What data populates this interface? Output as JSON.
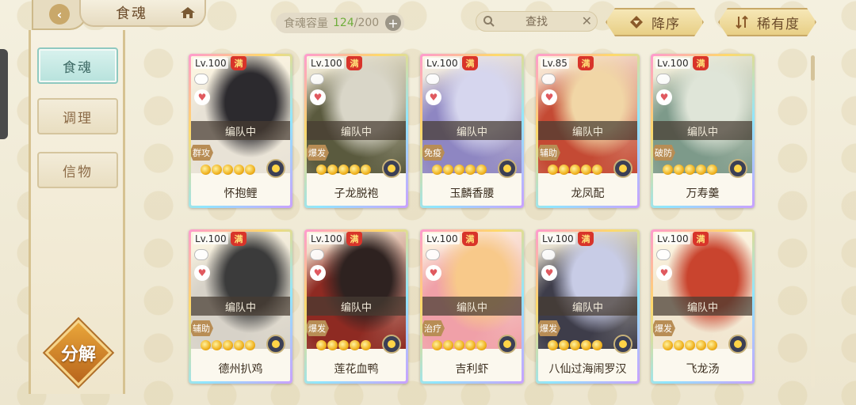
{
  "header": {
    "title": "食魂",
    "capacity_label": "食魂容量",
    "capacity_current": "124",
    "capacity_max": "/200",
    "add_label": "+",
    "search_placeholder": "查找",
    "sort_order_label": "降序",
    "sort_by_label": "稀有度"
  },
  "sidebar": {
    "items": [
      {
        "label": "食魂",
        "active": true
      },
      {
        "label": "调理",
        "active": false
      },
      {
        "label": "信物",
        "active": false
      }
    ],
    "decompose_label": "分解"
  },
  "cards": [
    {
      "level": "Lv.100",
      "max": "满",
      "status": "编队中",
      "role": "群攻",
      "name": "怀抱鲤",
      "palette": [
        "#2c2a2e",
        "#e8e2d6"
      ]
    },
    {
      "level": "Lv.100",
      "max": "满",
      "status": "编队中",
      "role": "爆发",
      "name": "子龙脱袍",
      "palette": [
        "#d9d6c8",
        "#5a5a3e"
      ]
    },
    {
      "level": "Lv.100",
      "max": "满",
      "status": "编队中",
      "role": "免疫",
      "name": "玉麟香腰",
      "palette": [
        "#d6d6ee",
        "#8e86c2"
      ]
    },
    {
      "level": "Lv.85",
      "max": "满",
      "status": "编队中",
      "role": "辅助",
      "name": "龙凤配",
      "palette": [
        "#f1d6a6",
        "#c44a34"
      ]
    },
    {
      "level": "Lv.100",
      "max": "满",
      "status": "编队中",
      "role": "破防",
      "name": "万寿羹",
      "palette": [
        "#dfe5d8",
        "#7d9a8a"
      ]
    },
    {
      "level": "Lv.100",
      "max": "满",
      "status": "编队中",
      "role": "辅助",
      "name": "德州扒鸡",
      "palette": [
        "#3b3b3b",
        "#d7d2c8"
      ]
    },
    {
      "level": "Lv.100",
      "max": "满",
      "status": "编队中",
      "role": "爆发",
      "name": "莲花血鸭",
      "palette": [
        "#2e2220",
        "#8e2a22"
      ]
    },
    {
      "level": "Lv.100",
      "max": "满",
      "status": "编队中",
      "role": "治疗",
      "name": "吉利虾",
      "palette": [
        "#f8c98a",
        "#f0a0a8"
      ]
    },
    {
      "level": "Lv.100",
      "max": "满",
      "status": "编队中",
      "role": "爆发",
      "name": "八仙过海闹罗汉",
      "palette": [
        "#c8cce6",
        "#3e3d4a"
      ]
    },
    {
      "level": "Lv.100",
      "max": "满",
      "status": "编队中",
      "role": "爆发",
      "name": "飞龙汤",
      "palette": [
        "#c9442e",
        "#f1e6d0"
      ]
    }
  ],
  "colors": {
    "accent_green": "#6fae3c",
    "badge_red": "#d8342a",
    "active_tab": "#b7e2dc"
  },
  "icons": {
    "back": "back-arrow-icon",
    "home": "home-icon",
    "search": "search-icon",
    "clear": "close-icon",
    "sort": "sort-icon",
    "filter": "rarity-icon"
  }
}
